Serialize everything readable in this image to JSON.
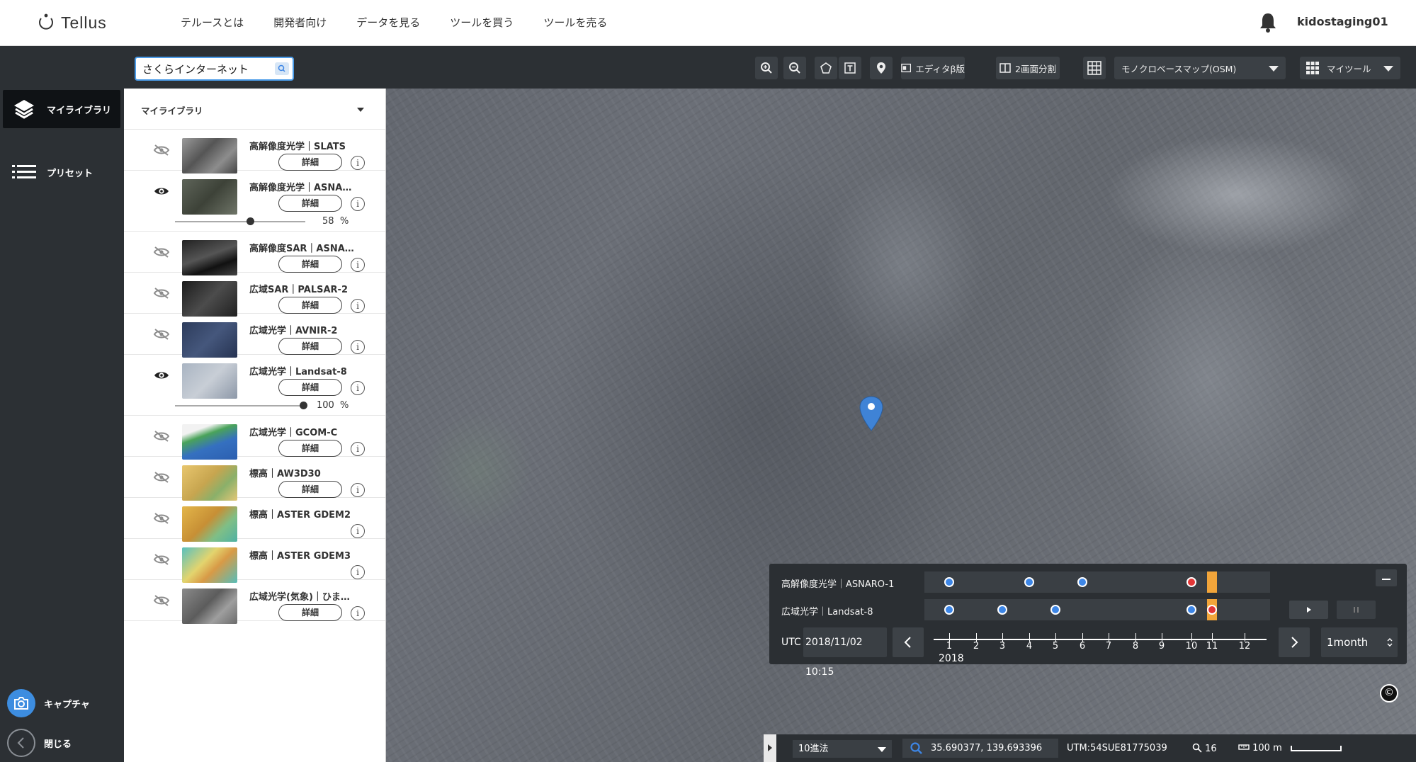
{
  "header": {
    "logo_text": "Tellus",
    "nav": [
      "テルースとは",
      "開発者向け",
      "データを見る",
      "ツールを買う",
      "ツールを売る"
    ],
    "username": "kidostaging01"
  },
  "rail": {
    "library_label": "マイライブラリ",
    "preset_label": "プリセット",
    "capture_label": "キャプチャ",
    "close_label": "閉じる"
  },
  "toolbar": {
    "search_value": "さくらインターネット",
    "editor_label": "エディタβ版",
    "split_label": "2画面分割",
    "basemap_label": "モノクロベースマップ(OSM)",
    "mytools_label": "マイツール"
  },
  "panel": {
    "title": "マイライブラリ",
    "detail_label": "詳細",
    "info_label": "i",
    "percent_sign": "%",
    "layers": [
      {
        "name": "高解像度光学｜SLATS",
        "visible": false,
        "has_detail": true
      },
      {
        "name": "高解像度光学｜ASNA…",
        "visible": true,
        "has_detail": true,
        "opacity": 58
      },
      {
        "name": "高解像度SAR｜ASNA…",
        "visible": false,
        "has_detail": true
      },
      {
        "name": "広域SAR｜PALSAR-2",
        "visible": false,
        "has_detail": true
      },
      {
        "name": "広域光学｜AVNIR-2",
        "visible": false,
        "has_detail": true
      },
      {
        "name": "広域光学｜Landsat-8",
        "visible": true,
        "has_detail": true,
        "opacity": 100
      },
      {
        "name": "広域光学｜GCOM-C",
        "visible": false,
        "has_detail": true
      },
      {
        "name": "標高｜AW3D30",
        "visible": false,
        "has_detail": true
      },
      {
        "name": "標高｜ASTER GDEM2",
        "visible": false,
        "has_detail": false
      },
      {
        "name": "標高｜ASTER GDEM3",
        "visible": false,
        "has_detail": false
      },
      {
        "name": "広域光学(気象)｜ひま…",
        "visible": false,
        "has_detail": true
      }
    ]
  },
  "timeline": {
    "series": [
      {
        "name": "高解像度光学｜ASNARO-1",
        "months": [
          1,
          4,
          6,
          10
        ],
        "selected_month": 10,
        "current_month": 11
      },
      {
        "name": "広域光学｜Landsat-8",
        "months": [
          1,
          3,
          5,
          10,
          11
        ],
        "selected_month": 11,
        "current_month": 11
      }
    ],
    "utc_label": "UTC",
    "utc_value": "2018/11/02 10:15",
    "months": [
      "1",
      "2",
      "3",
      "4",
      "5",
      "6",
      "7",
      "8",
      "9",
      "10",
      "11",
      "12"
    ],
    "year": "2018",
    "interval": "1month"
  },
  "statusbar": {
    "coord_format": "10進法",
    "coordinates": "35.690377, 139.693396",
    "utm": "UTM:54SUE81775039",
    "zoom": "16",
    "scale": "100 m"
  },
  "attribution": "©",
  "colors": {
    "dark_panel": "#2c3034",
    "accent_blue": "#3d86e6",
    "selected_red": "#e23636",
    "current_orange": "#f2a53a"
  }
}
